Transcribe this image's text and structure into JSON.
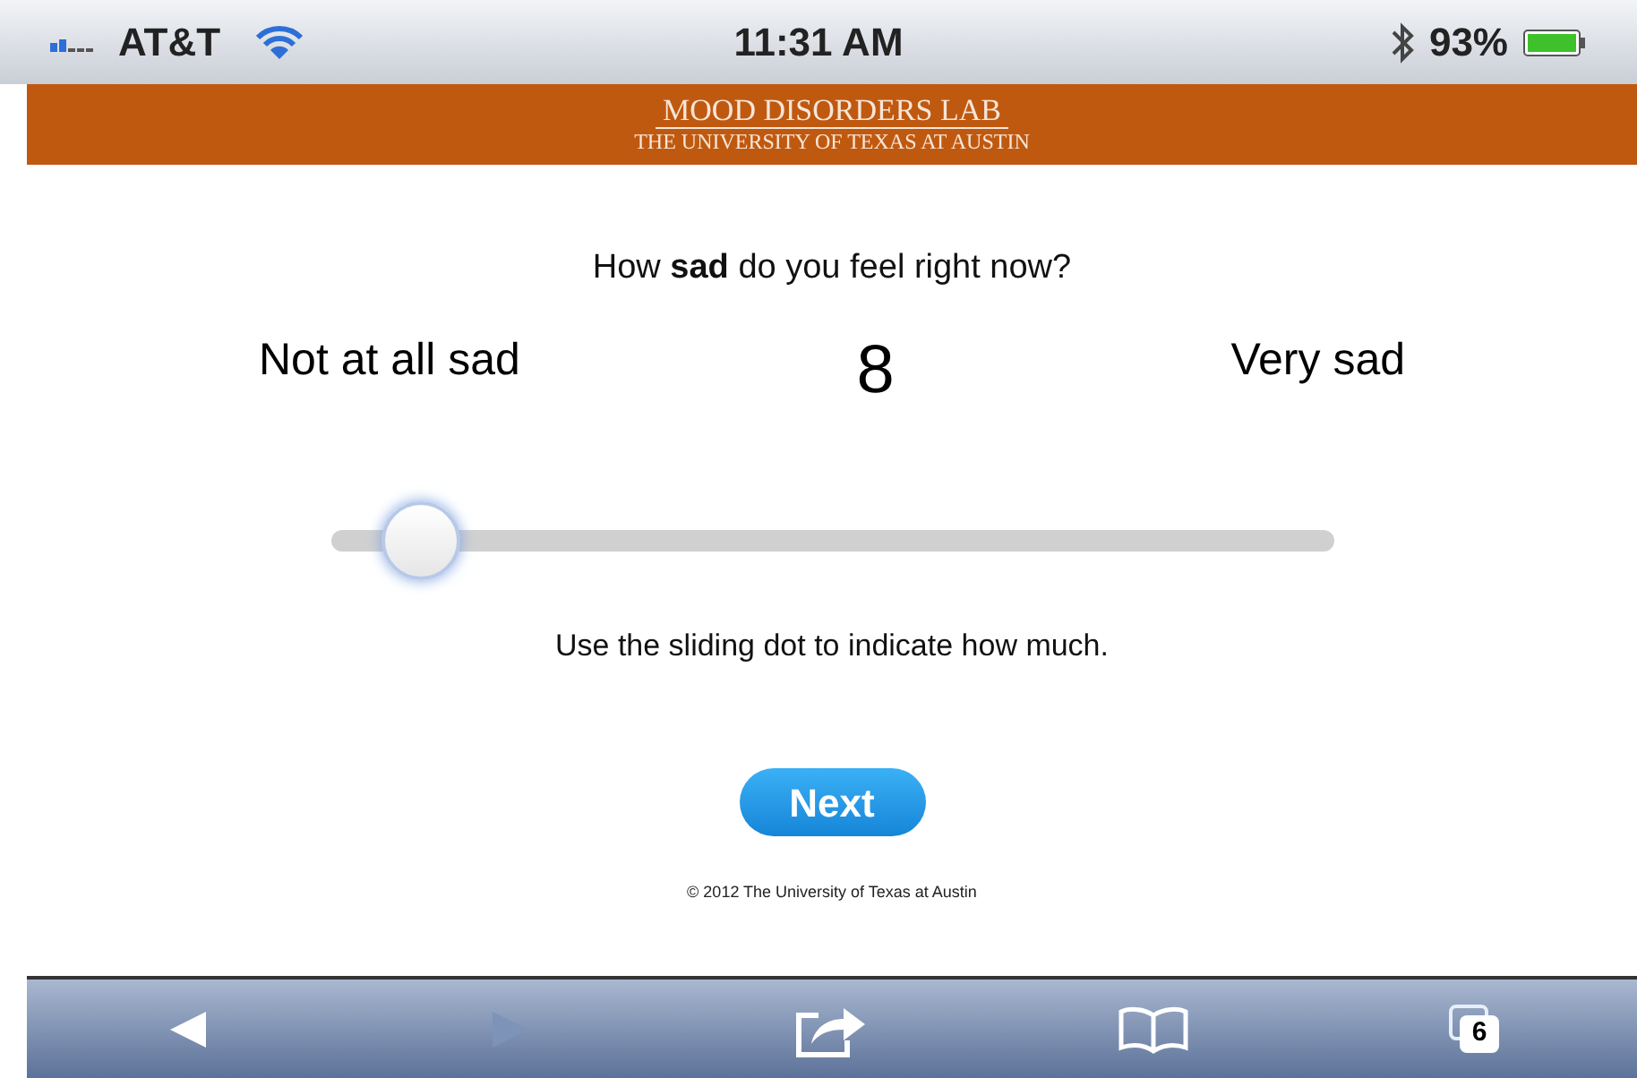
{
  "status_bar": {
    "carrier": "AT&T",
    "time": "11:31 AM",
    "battery": "93%"
  },
  "banner": {
    "title": "MOOD DISORDERS LAB",
    "subtitle": "THE UNIVERSITY OF TEXAS AT AUSTIN"
  },
  "question": "How **sad** do you feel right now?",
  "scale": {
    "low_label": "Not at all sad",
    "value": "8",
    "high_label": "Very sad",
    "level": 0.09
  },
  "hint": "Use the sliding dot to indicate how much.",
  "next_button": "Next",
  "footer": "© 2012 The University of Texas at Austin",
  "toolbar": {
    "back_disabled": false,
    "forward_disabled": true,
    "tab_count": "6"
  }
}
